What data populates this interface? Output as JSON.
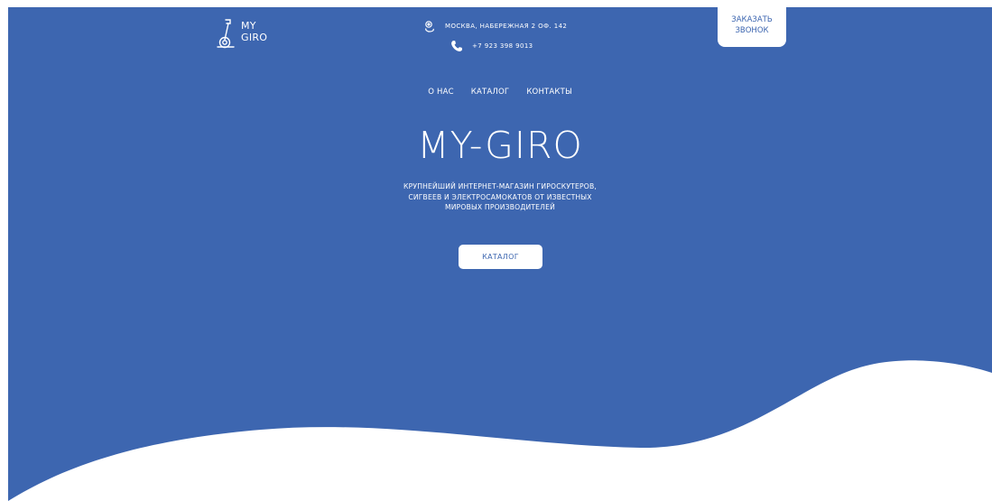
{
  "logo": {
    "line1": "MY",
    "line2": "GIRO",
    "icon": "gyroscooter-icon"
  },
  "contacts": {
    "address": "МОСКВА, НАБЕРЕЖНАЯ 2 ОФ. 142",
    "phone": "+7 923 398 9013",
    "address_icon": "location-icon",
    "phone_icon": "phone-icon"
  },
  "callback": {
    "line1": "ЗАКАЗАТЬ",
    "line2": "ЗВОНОК"
  },
  "nav": {
    "items": [
      "О НАС",
      "КАТАЛОГ",
      "КОНТАКТЫ"
    ]
  },
  "hero": {
    "title": "MY-GIRO",
    "subtitle_lines": [
      "КРУПНЕЙШИЙ ИНТЕРНЕТ-МАГАЗИН ГИРОСКУТЕРОВ,",
      "СИГВЕЕВ И ЭЛЕКТРОСАМОКАТОВ ОТ ИЗВЕСТНЫХ",
      "МИРОВЫХ ПРОИЗВОДИТЕЛЕЙ"
    ],
    "button_label": "КАТАЛОГ"
  },
  "colors": {
    "brand_blue": "#3d66b0",
    "white": "#ffffff"
  }
}
